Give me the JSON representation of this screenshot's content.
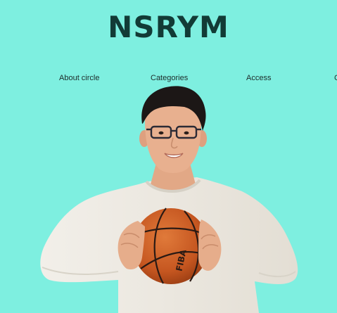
{
  "header": {
    "title": "NSRYM"
  },
  "nav": {
    "items": [
      {
        "label": "About circle"
      },
      {
        "label": "Categories"
      },
      {
        "label": "Access"
      },
      {
        "label": "C"
      }
    ]
  },
  "hero": {
    "ball_print": "FIBA",
    "colors": {
      "background": "#7eefe0",
      "shirt": "#eeeae3",
      "ball": "#c95a1e",
      "skin": "#e8b08f",
      "hair": "#1c1716"
    }
  }
}
